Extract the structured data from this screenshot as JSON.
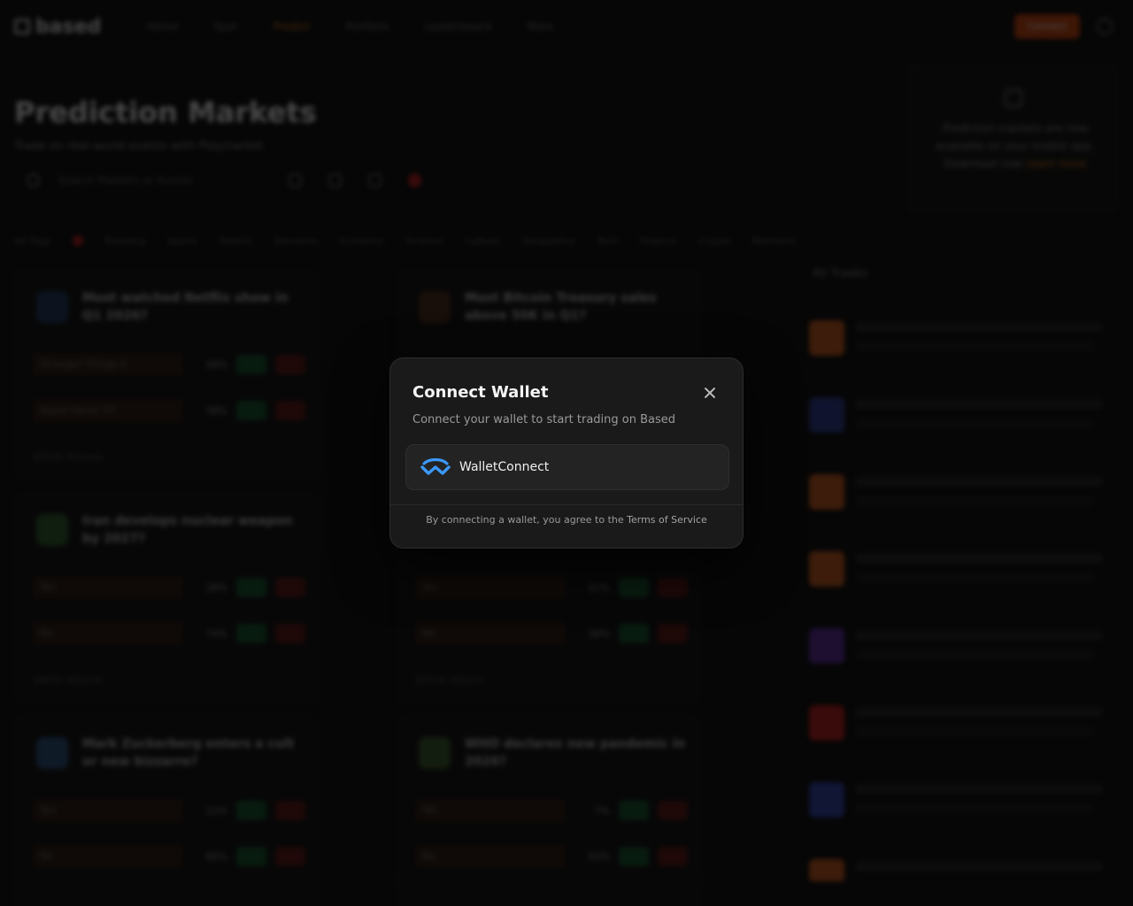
{
  "app": {
    "logo": "based",
    "nav": [
      "Home",
      "Spot",
      "Predict",
      "Portfolio",
      "Leaderboard",
      "More"
    ],
    "cta": "Connect",
    "page_title": "Prediction Markets",
    "page_subtitle": "Trade on real-world events with Polymarket",
    "search_placeholder": "Search Markets or Events",
    "promo_text": "Prediction markets are now available on your mobile app. Download now",
    "promo_link": "Learn more",
    "categories": [
      "All Tags",
      "Trending",
      "Sports",
      "Politics",
      "Elections",
      "Economy",
      "Science",
      "Culture",
      "Geopolitics",
      "Tech",
      "Finance",
      "Crypto",
      "Mentions"
    ],
    "cards": [
      {
        "title": "Most watched Netflix show in Q1 2026?",
        "rows": [
          {
            "name": "Stranger Things 5",
            "pct": "49%"
          },
          {
            "name": "Squid Game S3",
            "pct": "38%"
          }
        ],
        "foot": "$502k Volume"
      },
      {
        "title": "Most Bitcoin Treasury sales above 50K in Q1?",
        "rows": [],
        "foot": ""
      },
      {
        "title": "Iran develops nuclear weapon by 2027?",
        "rows": [
          {
            "name": "Yes",
            "pct": "28%"
          },
          {
            "name": "No",
            "pct": "74%"
          }
        ],
        "foot": "$841k Volume"
      },
      {
        "title": "",
        "rows": [
          {
            "name": "Yes",
            "pct": "62%"
          },
          {
            "name": "No",
            "pct": "38%"
          }
        ],
        "foot": "$411k Volume"
      },
      {
        "title": "Mark Zuckerberg enters a cult or new bizzarre?",
        "rows": [
          {
            "name": "Yes",
            "pct": "22%"
          },
          {
            "name": "No",
            "pct": "80%"
          }
        ],
        "foot": ""
      },
      {
        "title": "WHO declares new pandemic in 2026?",
        "rows": [
          {
            "name": "Yes",
            "pct": "7%"
          },
          {
            "name": "No",
            "pct": "93%"
          }
        ],
        "foot": ""
      }
    ],
    "trades_title": "All Trades",
    "trade_colors": [
      "#c2561c",
      "#2e3a8c",
      "#c2561c",
      "#c2561c",
      "#5b2b9c",
      "#b91c1c",
      "#3040a8",
      "#c2561c"
    ]
  },
  "modal": {
    "title": "Connect Wallet",
    "subtitle": "Connect your wallet to start trading on Based",
    "wallet_option": "WalletConnect",
    "terms_prefix": "By connecting a wallet, you agree to the ",
    "terms_link": "Terms of Service",
    "accent": "#3b99fc"
  }
}
